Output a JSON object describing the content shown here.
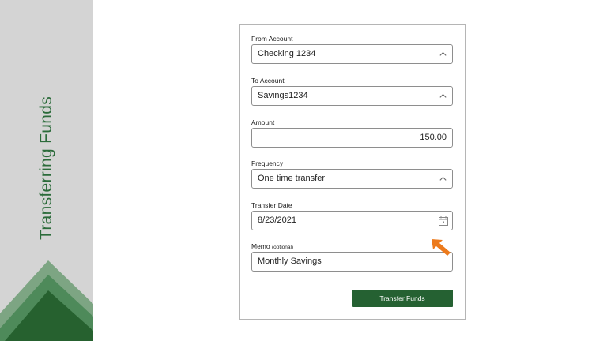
{
  "sidebar": {
    "title": "Transferring Funds"
  },
  "form": {
    "from_account": {
      "label": "From Account",
      "value": "Checking 1234"
    },
    "to_account": {
      "label": "To Account",
      "value": "Savings1234"
    },
    "amount": {
      "label": "Amount",
      "value": "150.00"
    },
    "frequency": {
      "label": "Frequency",
      "value": "One time transfer"
    },
    "transfer_date": {
      "label": "Transfer Date",
      "value": "8/23/2021"
    },
    "memo": {
      "label": "Memo",
      "optional": "(optional)",
      "value": "Monthly Savings"
    },
    "submit_label": "Transfer Funds"
  },
  "colors": {
    "brand_green": "#256132",
    "pointer_orange": "#ec7a1c",
    "sidebar_gray": "#d4d4d4"
  },
  "icons": {
    "select_arrow": "chevron-up-icon",
    "date_picker": "calendar-icon",
    "pointer": "arrow-pointer-icon"
  }
}
